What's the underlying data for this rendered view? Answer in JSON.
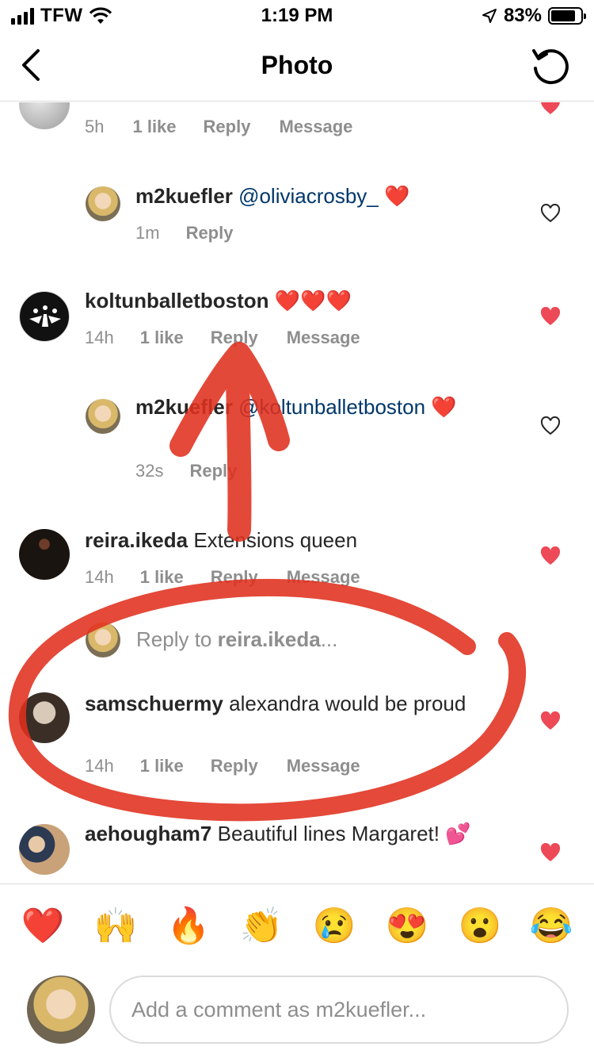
{
  "status_bar": {
    "carrier": "TFW",
    "time": "1:19 PM",
    "battery": "83%",
    "battery_level": 0.83
  },
  "header": {
    "title": "Photo"
  },
  "comments": [
    {
      "username": "",
      "text": "",
      "time": "5h",
      "likes": "1 like",
      "reply": "Reply",
      "message": "Message",
      "liked": true
    },
    {
      "username": "m2kuefler",
      "mention": "@oliviacrosby_",
      "emoji": "❤️",
      "time": "1m",
      "reply": "Reply",
      "liked": false
    },
    {
      "username": "koltunballetboston",
      "emoji": "❤️❤️❤️",
      "time": "14h",
      "likes": "1 like",
      "reply": "Reply",
      "message": "Message",
      "liked": true
    },
    {
      "username": "m2kuefler",
      "mention": "@koltunballetboston",
      "emoji": "❤️",
      "time": "32s",
      "reply": "Reply",
      "liked": false
    },
    {
      "username": "reira.ikeda",
      "text": "Extensions queen",
      "time": "14h",
      "likes": "1 like",
      "reply": "Reply",
      "message": "Message",
      "liked": true
    },
    {
      "username": "samschuermy",
      "text": "alexandra would be proud",
      "time": "14h",
      "likes": "1 like",
      "reply": "Reply",
      "message": "Message",
      "liked": true
    },
    {
      "username": "aehougham7",
      "text": "Beautiful lines Margaret!",
      "emoji": "💕",
      "liked": true
    }
  ],
  "reply_to": {
    "prefix": "Reply to ",
    "username": "reira.ikeda",
    "suffix": "..."
  },
  "emoji_bar": [
    "❤️",
    "🙌",
    "🔥",
    "👏",
    "😢",
    "😍",
    "😮",
    "😂"
  ],
  "composer": {
    "placeholder": "Add a comment as m2kuefler..."
  },
  "colors": {
    "heart_red": "#ed4956",
    "link_blue": "#00376b",
    "annotation_red": "#e0301e"
  },
  "icons": [
    "back-chevron-icon",
    "refresh-icon",
    "heart-icon",
    "heart-outline-icon",
    "wifi-icon",
    "location-arrow-icon"
  ]
}
